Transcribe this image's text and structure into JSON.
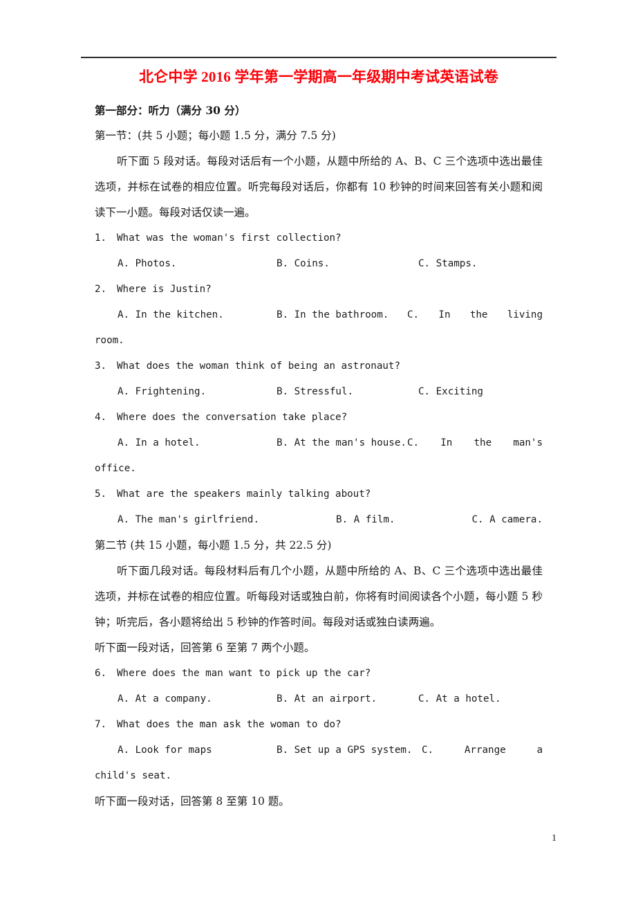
{
  "document": {
    "title": "北仑中学 2016 学年第一学期高一年级期中考试英语试卷",
    "title_color": "#fb0007",
    "page_number": "1"
  },
  "part1": {
    "heading": "第一部分：听力（满分 30 分）",
    "section1_heading": "第一节：(共 5 小题；每小题 1.5 分，满分 7.5 分)",
    "section1_instructions": "听下面 5 段对话。每段对话后有一个小题，从题中所给的 A、B、C 三个选项中选出最佳选项，并标在试卷的相应位置。听完每段对话后，你都有 10 秒钟的时间来回答有关小题和阅读下一小题。每段对话仅读一遍。",
    "section2_heading": "第二节 (共 15 小题，每小题 1.5 分，共 22.5 分)",
    "section2_instructions": "听下面几段对话。每段材料后有几个小题，从题中所给的 A、B、C 三个选项中选出最佳选项，并标在试卷的相应位置。听每段对话或独白前，你将有时间阅读各个小题，每小题 5 秒钟；听完后，各小题将给出 5 秒钟的作答时间。每段对话或独白读两遍。",
    "dialogue_note_6_7": "听下面一段对话，回答第 6 至第 7 两个小题。",
    "dialogue_note_8_10": "听下面一段对话，回答第 8 至第 10 题。"
  },
  "questions": [
    {
      "number": "1.",
      "stem": "What was the woman's first collection?",
      "options": {
        "a": "A. Photos.",
        "b": "B. Coins.",
        "c": "C. Stamps."
      }
    },
    {
      "number": "2.",
      "stem": "Where is Justin?",
      "options": {
        "a": "A. In the kitchen.",
        "b": "B. In the bathroom.",
        "c_label": "C.",
        "c_word1": "In",
        "c_word2": "the",
        "c_word3": "living",
        "c_continuation": "room."
      }
    },
    {
      "number": "3.",
      "stem": "What does the woman think of being an astronaut?",
      "options": {
        "a": "A. Frightening.",
        "b": "B. Stressful.",
        "c": "C. Exciting"
      }
    },
    {
      "number": "4.",
      "stem": "Where does the conversation take place?",
      "options": {
        "a": "A. In a hotel.",
        "b": "B. At the man's house.",
        "c_label": "C.",
        "c_word1": "In",
        "c_word2": "the",
        "c_word3": "man's",
        "c_continuation": "office."
      }
    },
    {
      "number": "5.",
      "stem": "What are the speakers mainly talking about?",
      "options": {
        "a": "A. The man's girlfriend.",
        "b": "B. A film.",
        "c": "C. A camera."
      }
    },
    {
      "number": "6.",
      "stem": "Where does the man want to pick up the car?",
      "options": {
        "a": "A. At a company.",
        "b": "B. At an airport.",
        "c": "C. At a hotel."
      }
    },
    {
      "number": "7.",
      "stem": "What does the man ask the woman to do?",
      "options": {
        "a": "A. Look for maps",
        "b": "B. Set up a GPS system.",
        "c_label": "C.",
        "c_word1": "Arrange",
        "c_word2": "a",
        "c_continuation": "child's seat."
      }
    }
  ]
}
